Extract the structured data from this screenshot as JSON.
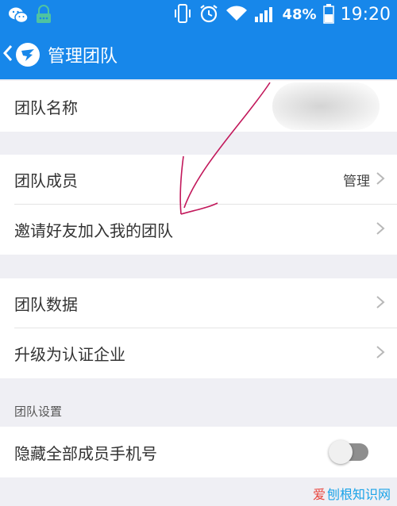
{
  "status_bar": {
    "battery_percent": "48%",
    "time": "19:20",
    "icons": [
      "wechat-icon",
      "notification-icon",
      "vibrate-icon",
      "alarm-icon",
      "wifi-icon",
      "signal-icon",
      "battery-icon"
    ]
  },
  "app_bar": {
    "title": "管理团队",
    "back_icon": "chevron-left-icon",
    "logo_icon": "dingtalk-logo-icon"
  },
  "team_name": {
    "label": "团队名称"
  },
  "members": {
    "label": "团队成员",
    "value": "管理"
  },
  "invite": {
    "label": "邀请好友加入我的团队"
  },
  "data": {
    "label": "团队数据"
  },
  "upgrade": {
    "label": "升级为认证企业"
  },
  "settings": {
    "section_title": "团队设置",
    "hide_phone": {
      "label": "隐藏全部成员手机号",
      "enabled": false
    }
  },
  "watermark": {
    "text_a": "爱",
    "text_b": "刨根知识网"
  },
  "colors": {
    "primary": "#1787ea",
    "background": "#efeff4",
    "annotation": "#c2185b"
  }
}
